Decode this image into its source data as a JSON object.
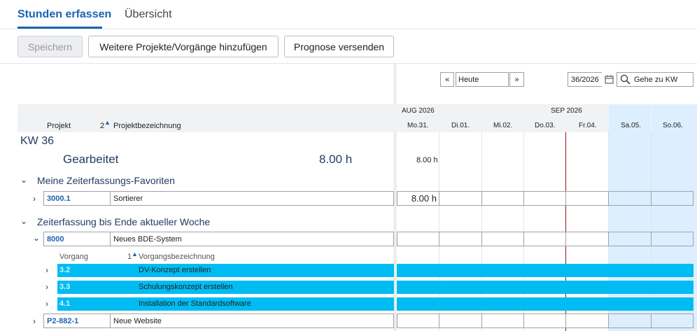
{
  "tabs": [
    {
      "label": "Stunden erfassen",
      "active": true
    },
    {
      "label": "Übersicht",
      "active": false
    }
  ],
  "toolbar": {
    "save": "Speichern",
    "add_projects": "Weitere Projekte/Vorgänge hinzufügen",
    "send_forecast": "Prognose versenden"
  },
  "nav": {
    "prev": "«",
    "today": "Heute",
    "next": "»",
    "week_value": "36/2026",
    "goto": "Gehe zu KW"
  },
  "grid_header": {
    "col_project": "Projekt",
    "sort_index": "2",
    "col_project_name": "Projektbezeichnung",
    "month_aug": "AUG 2026",
    "month_sep": "SEP 2026",
    "days": [
      "Mo.31.",
      "Di.01.",
      "Mi.02.",
      "Do.03.",
      "Fr.04.",
      "Sa.05.",
      "So.06."
    ]
  },
  "week": {
    "label": "KW 36",
    "worked_label": "Gearbeitet",
    "worked_total": "8.00 h",
    "day_total_mo": "8.00 h"
  },
  "favorites": {
    "title": "Meine Zeiterfassungs-Favoriten",
    "rows": [
      {
        "code": "3000.1",
        "name": "Sortierer",
        "mo": "8.00 h"
      }
    ]
  },
  "until_week_end": {
    "title": "Zeiterfassung bis Ende aktueller Woche",
    "project": {
      "code": "8000",
      "name": "Neues BDE-System"
    },
    "sub_header": {
      "col_vorgang": "Vorgang",
      "sort_index": "1",
      "col_name": "Vorgangsbezeichnung"
    },
    "tasks": [
      {
        "code": "3.2",
        "name": "DV-Konzept erstellen"
      },
      {
        "code": "3.3",
        "name": "Schulungskonzept erstellen"
      },
      {
        "code": "4.1",
        "name": "Installation der Standardsoftware"
      }
    ],
    "next_project": {
      "code": "P2-882-1",
      "name": "Neue Website"
    }
  },
  "colors": {
    "accent": "#1a63b3",
    "task_bar": "#00bcf2",
    "weekend": "#ddeeff",
    "today_line": "#8b1a1a"
  }
}
